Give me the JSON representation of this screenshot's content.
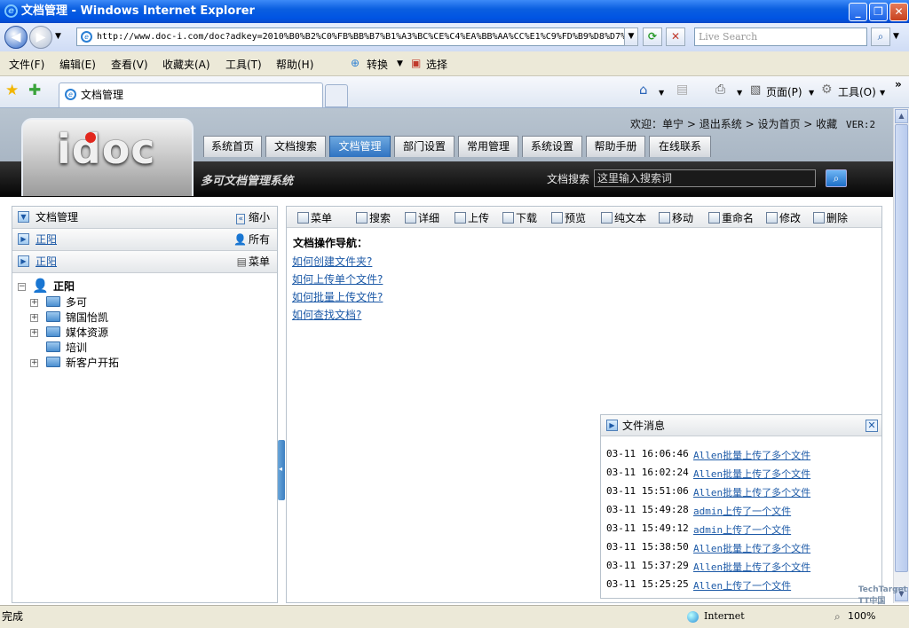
{
  "window": {
    "title": "文档管理 - Windows Internet Explorer"
  },
  "browser": {
    "url": "http://www.doc-i.com/doc?adkey=2010%B0%B2%C0%FB%BB%B7%B1%A3%BC%CE%C4%EA%BB%AA%CC%E1%C9%FD%B9%D8%D7%",
    "search_placeholder": "Live Search",
    "menus": [
      "文件(F)",
      "编辑(E)",
      "查看(V)",
      "收藏夹(A)",
      "工具(T)",
      "帮助(H)"
    ],
    "menu_extra": {
      "convert": "转换",
      "select": "选择"
    },
    "tab_title": "文档管理",
    "tab_tools": {
      "page": "页面(P)",
      "tools": "工具(O)"
    },
    "status_text": "完成",
    "zone": "Internet",
    "zoom": "100%"
  },
  "app": {
    "logo_text": "idoc",
    "system_name": "多可文档管理系统",
    "nav_tabs": [
      "系统首页",
      "文档搜索",
      "文档管理",
      "部门设置",
      "常用管理",
      "系统设置",
      "帮助手册",
      "在线联系"
    ],
    "active_tab": "文档管理",
    "welcome": {
      "greeting": "欢迎：",
      "user": "单宁",
      "logout": "退出系统",
      "set_home": "设为首页",
      "favorite": "收藏",
      "version": "VER:2"
    },
    "doc_search": {
      "label": "文档搜索",
      "placeholder": "这里输入搜索词"
    },
    "left_panel": {
      "header": "文档管理",
      "collapse": "缩小",
      "row2_link": "正阳",
      "row2_right": "所有",
      "row3_link": "正阳",
      "row3_right": "菜单",
      "tree": {
        "root": "正阳",
        "children": [
          {
            "label": "多可",
            "expandable": true
          },
          {
            "label": "锦国怡凯",
            "expandable": true
          },
          {
            "label": "媒体资源",
            "expandable": true
          },
          {
            "label": "培训",
            "expandable": false
          },
          {
            "label": "新客户开拓",
            "expandable": true
          }
        ]
      }
    },
    "toolbar": [
      "菜单",
      "搜索",
      "详细",
      "上传",
      "下载",
      "预览",
      "纯文本",
      "移动",
      "重命名",
      "修改",
      "删除"
    ],
    "guide": {
      "title": "文档操作导航：",
      "links": [
        "如何创建文件夹?",
        "如何上传单个文件?",
        "如何批量上传文件?",
        "如何查找文档?"
      ]
    },
    "messages": {
      "title": "文件消息",
      "items": [
        {
          "time": "03-11 16:06:46",
          "text": "Allen批量上传了多个文件"
        },
        {
          "time": "03-11 16:02:24",
          "text": "Allen批量上传了多个文件"
        },
        {
          "time": "03-11 15:51:06",
          "text": "Allen批量上传了多个文件"
        },
        {
          "time": "03-11 15:49:28",
          "text": "admin上传了一个文件"
        },
        {
          "time": "03-11 15:49:12",
          "text": "admin上传了一个文件"
        },
        {
          "time": "03-11 15:38:50",
          "text": "Allen批量上传了多个文件"
        },
        {
          "time": "03-11 15:37:29",
          "text": "Allen批量上传了多个文件"
        },
        {
          "time": "03-11 15:25:25",
          "text": "Allen上传了一个文件"
        }
      ]
    }
  },
  "watermark": "TechTarget TT中国"
}
